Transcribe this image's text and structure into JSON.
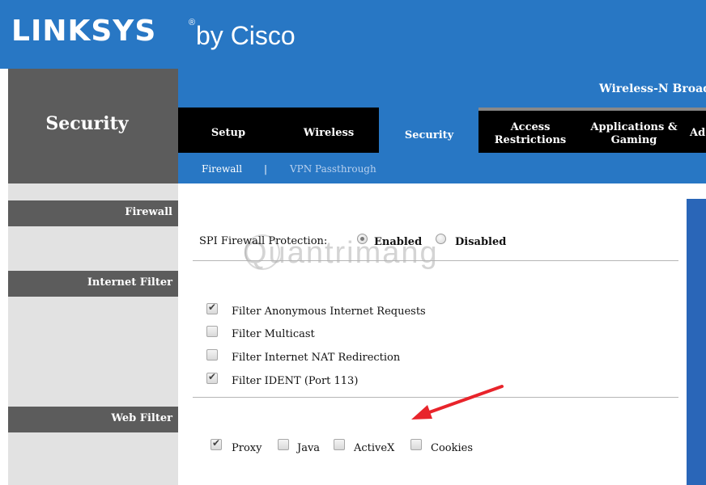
{
  "brand": {
    "logo": "LINKSYS",
    "registered": "®",
    "sub": "by Cisco",
    "color": "#2877c4"
  },
  "product": {
    "name": "Wireless-N Broad"
  },
  "section_title": "Security",
  "tabs": [
    {
      "label": "Setup"
    },
    {
      "label": "Wireless"
    },
    {
      "label": "Security",
      "active": true
    },
    {
      "label": "Access Restrictions"
    },
    {
      "label": "Applications & Gaming"
    },
    {
      "label": "Ad"
    }
  ],
  "subnav": [
    {
      "label": "Firewall",
      "active": true
    },
    {
      "label": "|"
    },
    {
      "label": "VPN Passthrough"
    }
  ],
  "sidebar": {
    "firewall": "Firewall",
    "internet_filter": "Internet Filter",
    "web_filter": "Web Filter"
  },
  "spi": {
    "label": "SPI Firewall Protection:",
    "options": [
      {
        "label": "Enabled",
        "selected": true
      },
      {
        "label": "Disabled",
        "selected": false
      }
    ]
  },
  "internet_filters": [
    {
      "label": "Filter Anonymous Internet Requests",
      "checked": true
    },
    {
      "label": "Filter Multicast",
      "checked": false
    },
    {
      "label": "Filter Internet NAT Redirection",
      "checked": false
    },
    {
      "label": "Filter IDENT (Port 113)",
      "checked": true
    }
  ],
  "web_filters": [
    {
      "label": "Proxy",
      "checked": true
    },
    {
      "label": "Java",
      "checked": false
    },
    {
      "label": "ActiveX",
      "checked": false
    },
    {
      "label": "Cookies",
      "checked": false
    }
  ],
  "watermark": "Quantrimang",
  "annotation": {
    "arrow_color": "#e8242b"
  }
}
